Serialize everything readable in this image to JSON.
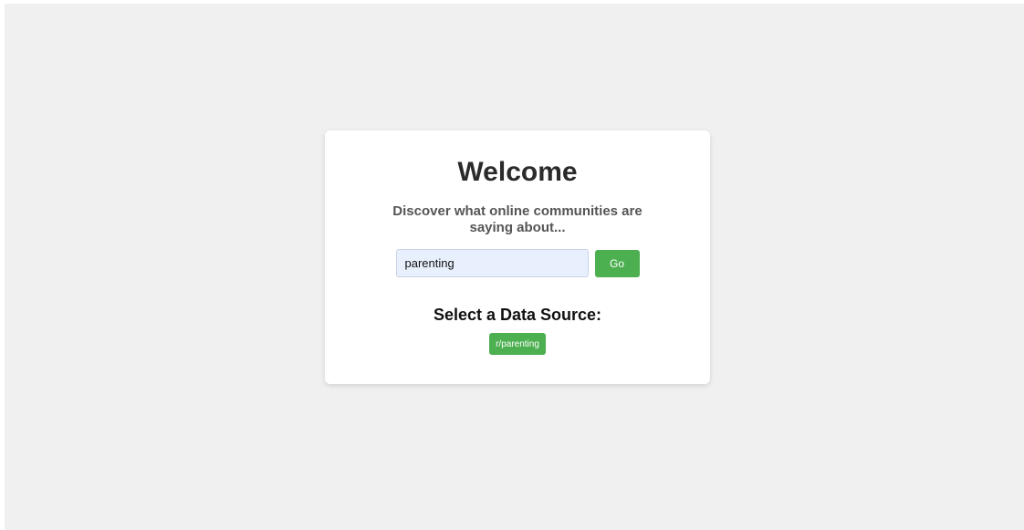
{
  "welcome": {
    "title": "Welcome",
    "subtitle": "Discover what online communities are saying about..."
  },
  "search": {
    "value": "parenting",
    "go_label": "Go"
  },
  "sources": {
    "heading": "Select a Data Source:",
    "items": [
      {
        "label": "r/parenting"
      }
    ]
  },
  "colors": {
    "background": "#f0f0f0",
    "card": "#ffffff",
    "accent": "#4caf50",
    "input_fill": "#e8f0fe"
  }
}
